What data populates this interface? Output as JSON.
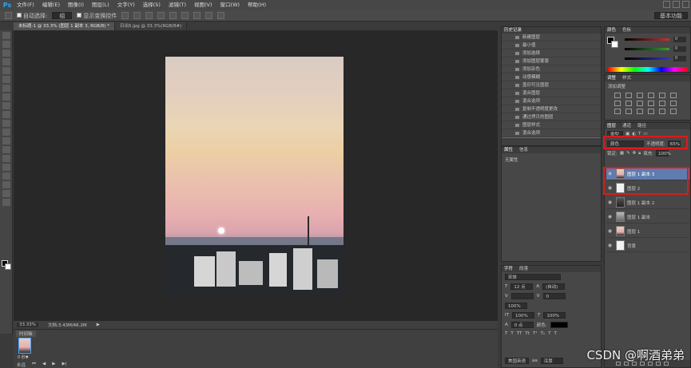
{
  "app": {
    "logo": "Ps"
  },
  "menu": [
    "文件(F)",
    "编辑(E)",
    "图像(I)",
    "图层(L)",
    "文字(Y)",
    "选择(S)",
    "滤镜(T)",
    "视图(V)",
    "窗口(W)",
    "帮助(H)"
  ],
  "options": {
    "auto_select": "自动选择:",
    "auto_select_value": "组",
    "show_transform": "显示变换控件",
    "workspace": "基本功能"
  },
  "tabs": [
    {
      "label": "未标题-1 @ 33.3% (图层 1 副本 3, RGB/8) *",
      "active": true
    },
    {
      "label": "日出5.jpg @ 33.3%(RGB/8#)",
      "active": false
    }
  ],
  "status": {
    "zoom": "33.33%",
    "doc": "文档:3.43M/46.2M"
  },
  "timeline": {
    "title": "时间轴",
    "frame_label": "0 秒▼",
    "loop": "永远"
  },
  "history": {
    "tabs": [
      "历史记录"
    ],
    "items": [
      "新建图层",
      "最小值",
      "添加选择",
      "添加图层蒙版",
      "添加杂色",
      "动感模糊",
      "盖印可见图层",
      "混合图层",
      "混合选项",
      "复制不透明度更改",
      "通过拷贝的图层",
      "图层样式",
      "混合选项",
      "复制不透明度更改"
    ],
    "selected_index": 13
  },
  "properties": {
    "tabs": [
      "属性",
      "信息"
    ],
    "empty": "无属性"
  },
  "character": {
    "tabs": [
      "字符",
      "段落"
    ],
    "font": "宋体",
    "size": "12 点",
    "leading": "(自动)",
    "tracking": "0",
    "scale_v": "100%",
    "scale_h": "100%",
    "baseline": "0 点",
    "color_label": "颜色:",
    "aa": "浑厚",
    "lang": "美国英语"
  },
  "color_panel": {
    "tabs": [
      "颜色",
      "色板"
    ],
    "r": "0",
    "g": "0",
    "b": "0",
    "slider_colors": [
      "#c83232",
      "#32a032",
      "#3232c8"
    ]
  },
  "adjustments": {
    "tabs": [
      "调整",
      "样式"
    ],
    "title": "添加调整"
  },
  "layers_panel": {
    "tabs": [
      "图层",
      "通道",
      "路径"
    ],
    "kind": "类型",
    "blend_mode": "颜色",
    "opacity_label": "不透明度:",
    "opacity": "65%",
    "lock_label": "锁定:",
    "fill_label": "填充:",
    "fill": "100%",
    "layers": [
      {
        "name": "图层 1 副本 3",
        "selected": true,
        "thumb": "sunset"
      },
      {
        "name": "图层 2",
        "selected": false,
        "thumb": "white"
      },
      {
        "name": "图层 1 副本 2",
        "selected": false,
        "thumb": "dark"
      },
      {
        "name": "图层 1 副本",
        "selected": false,
        "thumb": "gray"
      },
      {
        "name": "图层 1",
        "selected": false,
        "thumb": "sunset"
      },
      {
        "name": "背景",
        "selected": false,
        "thumb": "white"
      }
    ]
  },
  "watermark": "CSDN @啊酒弟弟"
}
